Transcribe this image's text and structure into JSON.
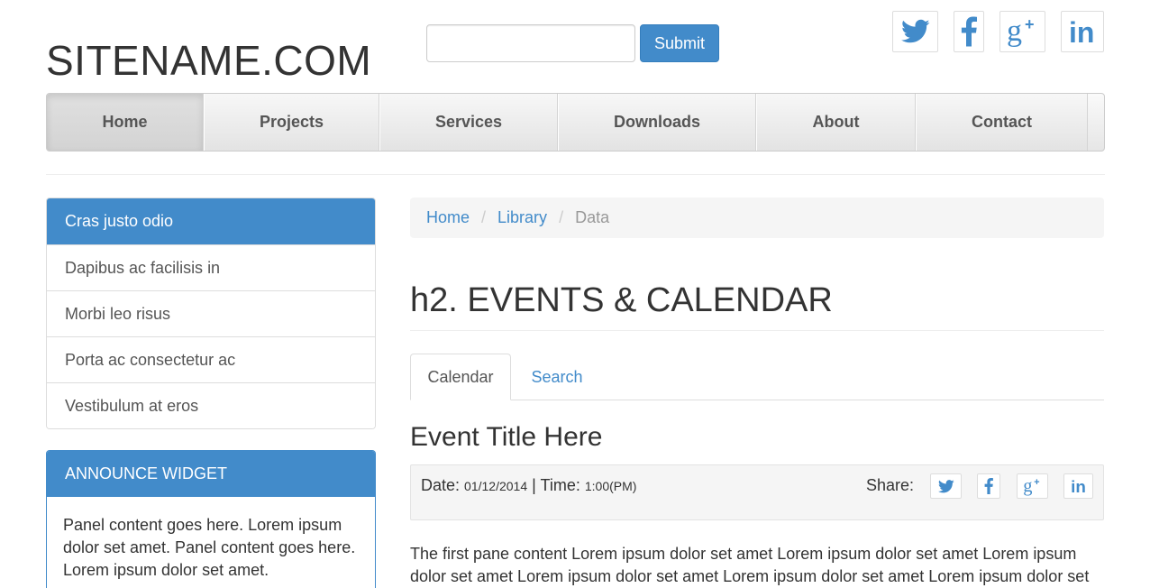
{
  "header": {
    "site_title": "SITENAME.COM",
    "search": {
      "value": "",
      "placeholder": ""
    },
    "submit_label": "Submit",
    "social": [
      "twitter-icon",
      "facebook-icon",
      "google-plus-icon",
      "linkedin-icon"
    ]
  },
  "nav": {
    "items": [
      {
        "label": "Home",
        "active": true
      },
      {
        "label": "Projects"
      },
      {
        "label": "Services"
      },
      {
        "label": "Downloads"
      },
      {
        "label": "About"
      },
      {
        "label": "Contact"
      }
    ]
  },
  "sidebar": {
    "list": [
      {
        "label": "Cras justo odio",
        "active": true
      },
      {
        "label": "Dapibus ac facilisis in"
      },
      {
        "label": "Morbi leo risus"
      },
      {
        "label": "Porta ac consectetur ac"
      },
      {
        "label": "Vestibulum at eros"
      }
    ],
    "widget": {
      "title": "ANNOUNCE WIDGET",
      "body": "Panel content goes here. Lorem ipsum dolor set amet. Panel content goes here. Lorem ipsum dolor set amet."
    }
  },
  "breadcrumb": {
    "items": [
      "Home",
      "Library",
      "Data"
    ],
    "separator": "/"
  },
  "main": {
    "heading": "h2. EVENTS & CALENDAR",
    "tabs": [
      {
        "label": "Calendar",
        "active": true
      },
      {
        "label": "Search"
      }
    ],
    "event": {
      "title": "Event Title Here",
      "date_label": "Date:",
      "date_value": "01/12/2014",
      "divider": "|",
      "time_label": "Time:",
      "time_value": "1:00(PM)",
      "share_label": "Share:"
    },
    "body": "The first pane content Lorem ipsum dolor set amet Lorem ipsum dolor set amet Lorem ipsum dolor set amet Lorem ipsum dolor set amet Lorem ipsum dolor set amet Lorem ipsum dolor set"
  },
  "colors": {
    "primary": "#428bca",
    "text": "#333333",
    "muted": "#999999",
    "well": "#f5f5f5"
  }
}
